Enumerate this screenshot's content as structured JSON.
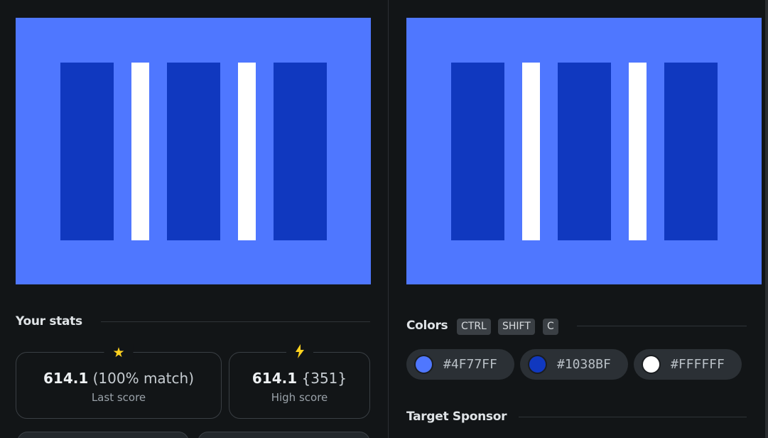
{
  "left_panel": {
    "stats_title": "Your stats",
    "last_score": {
      "value": "614.1",
      "detail": "(100% match)",
      "label": "Last score",
      "icon": "star-icon"
    },
    "high_score": {
      "value": "614.1",
      "detail": "{351}",
      "label": "High score",
      "icon": "lightning-icon"
    }
  },
  "right_panel": {
    "colors_title": "Colors",
    "shortcut_keys": [
      "CTRL",
      "SHIFT",
      "C"
    ],
    "colors": [
      {
        "hex": "#4F77FF",
        "swatch": "#4f77ff"
      },
      {
        "hex": "#1038BF",
        "swatch": "#1038bf"
      },
      {
        "hex": "#FFFFFF",
        "swatch": "#ffffff"
      }
    ],
    "sponsor_title": "Target Sponsor"
  },
  "palette": {
    "background": "#4f77ff",
    "dark_bar": "#1038bf",
    "white_bar": "#ffffff"
  }
}
